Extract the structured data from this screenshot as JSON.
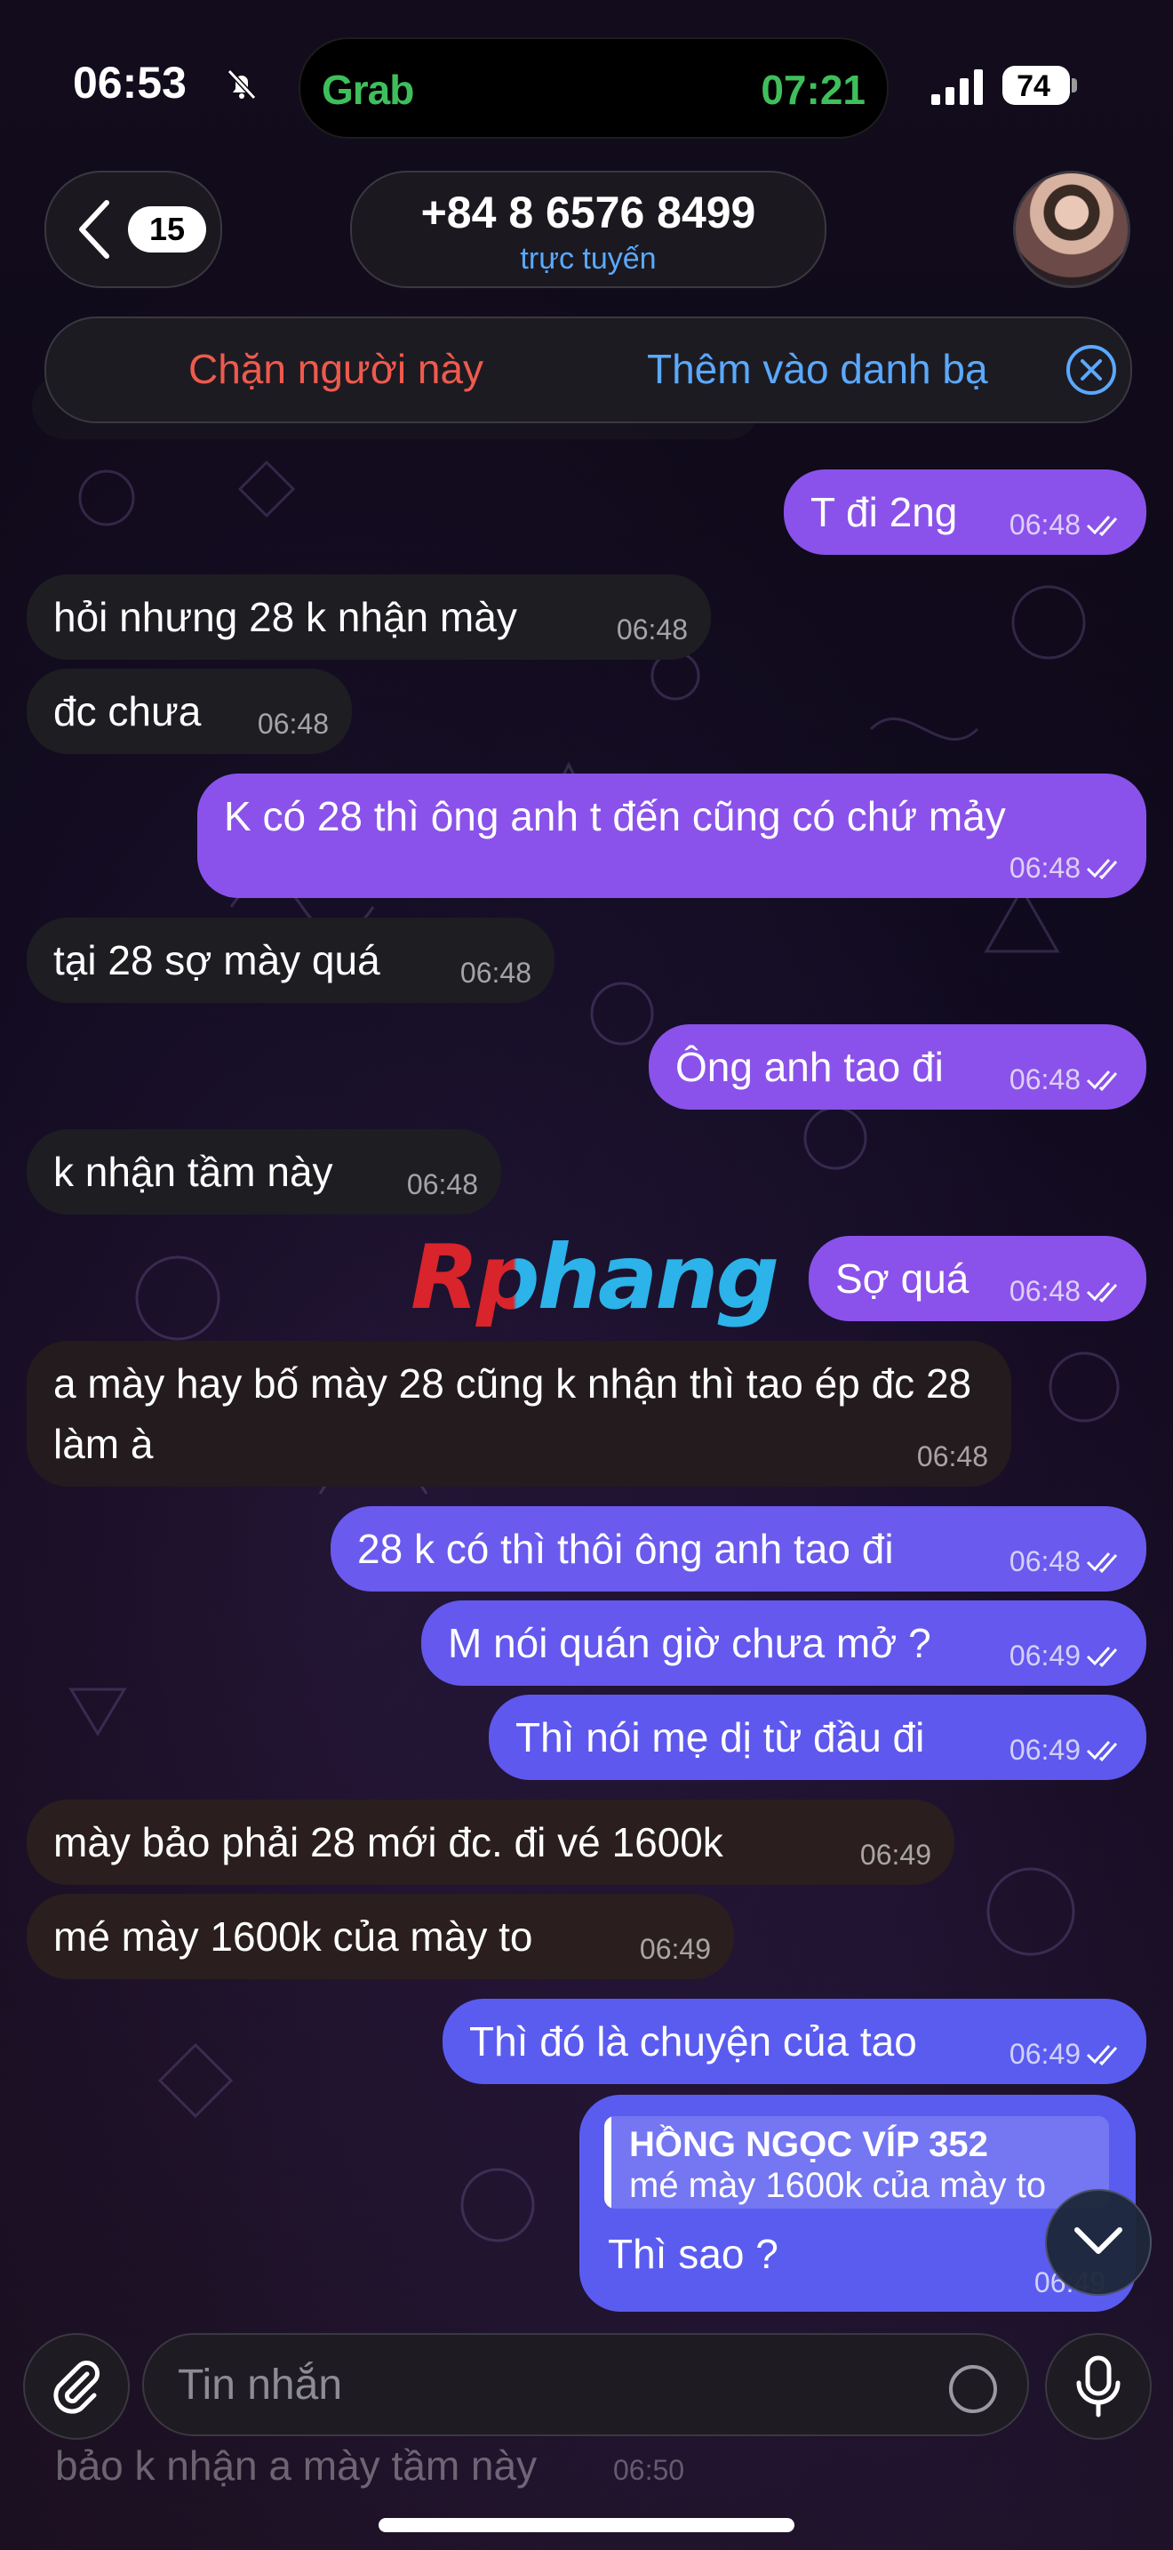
{
  "status_bar": {
    "time": "06:53",
    "island_app": "Grab",
    "island_time": "07:21",
    "battery": "74"
  },
  "header": {
    "unread_count": "15",
    "contact_phone": "+84 8 6576 8499",
    "contact_status": "trực tuyến",
    "block_label": "Chặn người này",
    "add_contact_label": "Thêm vào danh bạ"
  },
  "messages": [
    {
      "dir": "out",
      "text": "T đi 2ng",
      "time": "06:48"
    },
    {
      "dir": "in",
      "text": "hỏi nhưng 28 k nhận mày",
      "time": "06:48"
    },
    {
      "dir": "in",
      "text": "đc chưa",
      "time": "06:48"
    },
    {
      "dir": "out",
      "text": "K có 28 thì ông anh t đến cũng có chứ mảy",
      "time": "06:48"
    },
    {
      "dir": "in",
      "text": "tại 28 sợ mày quá",
      "time": "06:48"
    },
    {
      "dir": "out",
      "text": "Ông anh tao đi",
      "time": "06:48"
    },
    {
      "dir": "in",
      "text": "k nhận tầm này",
      "time": "06:48"
    },
    {
      "dir": "out",
      "text": "Sợ quá",
      "time": "06:48"
    },
    {
      "dir": "in",
      "text": "a mày hay bố mày 28 cũng k nhận thì tao ép đc 28 làm à",
      "time": "06:48"
    },
    {
      "dir": "out",
      "text": "28 k có thì thôi ông anh tao đi",
      "time": "06:48"
    },
    {
      "dir": "out",
      "text": "M nói quán giờ chưa mở ?",
      "time": "06:49"
    },
    {
      "dir": "out",
      "text": "Thì nói mẹ dị từ đầu đi",
      "time": "06:49"
    },
    {
      "dir": "in",
      "text": "mày bảo phải 28 mới đc. đi vé 1600k",
      "time": "06:49"
    },
    {
      "dir": "in",
      "text": "mé mày 1600k của mày to",
      "time": "06:49"
    },
    {
      "dir": "out",
      "text": "Thì đó là chuyện của tao",
      "time": "06:49"
    }
  ],
  "reply_message": {
    "quote_author": "HỒNG NGỌC VÍP 352",
    "quote_text": "mé mày 1600k của mày to",
    "text": "Thì sao ?",
    "time": "06:49"
  },
  "watermark": "Rphang",
  "composer": {
    "placeholder": "Tin nhắn",
    "under_preview_text": "bảo k nhận a mày tầm này",
    "under_preview_time": "06:50"
  },
  "colors": {
    "outgoing_bubble": "#8a52ea",
    "outgoing_bubble_late": "#5a5cf0",
    "incoming_bubble": "#1d1d22",
    "link_blue": "#5aa9ff",
    "danger_red": "#ef5a4d"
  },
  "icons": [
    "bell-slash-icon",
    "signal-icon",
    "chevron-left-icon",
    "close-circle-icon",
    "double-check-icon",
    "chevron-down-icon",
    "paperclip-icon",
    "sticker-icon",
    "microphone-icon"
  ]
}
